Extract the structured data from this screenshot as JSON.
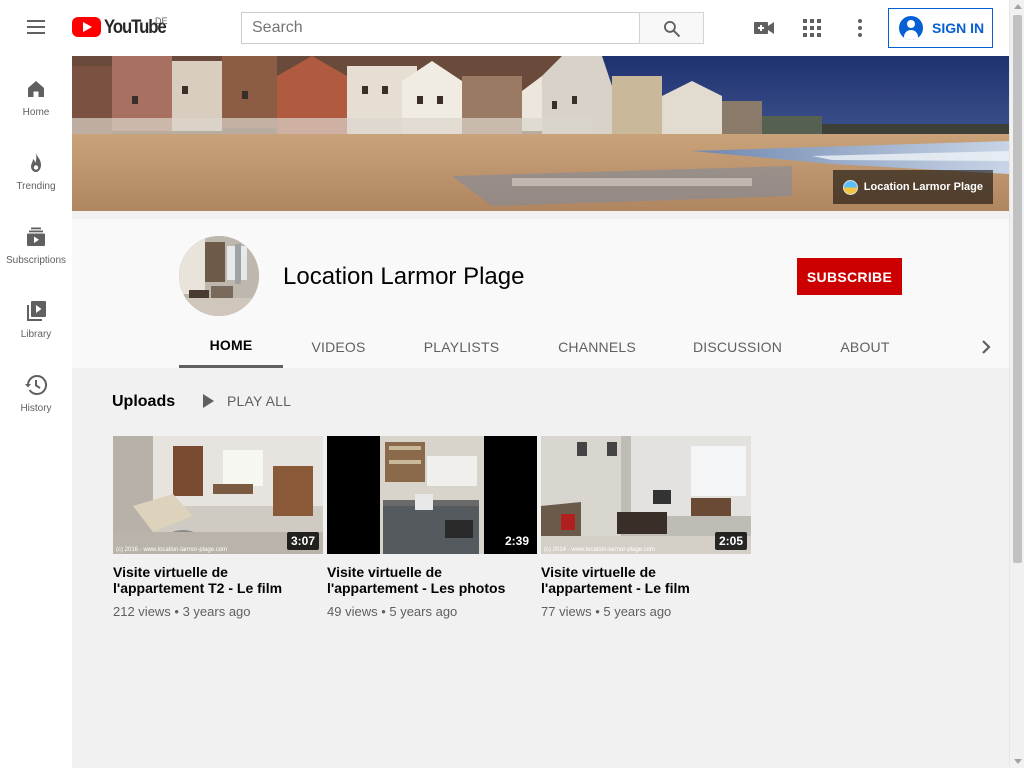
{
  "masthead": {
    "logo_text": "YouTube",
    "country_code": "DE",
    "search_placeholder": "Search",
    "signin_label": "SIGN IN"
  },
  "sidebar": {
    "items": [
      {
        "label": "Home",
        "icon": "home-icon"
      },
      {
        "label": "Trending",
        "icon": "trending-icon"
      },
      {
        "label": "Subscriptions",
        "icon": "subscriptions-icon"
      },
      {
        "label": "Library",
        "icon": "library-icon"
      },
      {
        "label": "History",
        "icon": "history-icon"
      }
    ]
  },
  "banner": {
    "link_label": "Location Larmor Plage"
  },
  "channel": {
    "name": "Location Larmor Plage",
    "subscribe_label": "SUBSCRIBE",
    "tabs": [
      "HOME",
      "VIDEOS",
      "PLAYLISTS",
      "CHANNELS",
      "DISCUSSION",
      "ABOUT"
    ],
    "active_tab": "HOME"
  },
  "uploads": {
    "title": "Uploads",
    "play_all_label": "PLAY ALL",
    "videos": [
      {
        "title_line1": "Visite virtuelle de",
        "title_line2": "l'appartement T2 - Le film",
        "duration": "3:07",
        "meta": "212 views • 3 years ago",
        "watermark": "(c) 2016 - www.location-larmor-plage.com"
      },
      {
        "title_line1": "Visite virtuelle de",
        "title_line2": "l'appartement - Les photos",
        "duration": "2:39",
        "meta": "49 views • 5 years ago",
        "watermark": ""
      },
      {
        "title_line1": "Visite virtuelle de",
        "title_line2": "l'appartement - Le film",
        "duration": "2:05",
        "meta": "77 views • 5 years ago",
        "watermark": "(c) 2014 - www.location-larmor-plage.com"
      }
    ]
  },
  "colors": {
    "brand_red": "#ff0000",
    "subscribe_red": "#cc0000",
    "signin_blue": "#065fd4"
  }
}
